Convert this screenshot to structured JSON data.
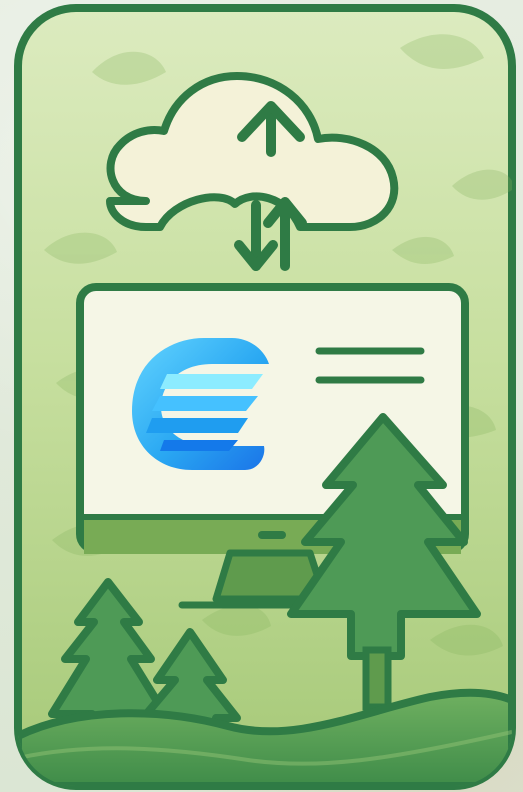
{
  "illustration": {
    "subject": "cloud-sync-eco-computer",
    "icons": [
      "leaf-icon",
      "cloud-icon",
      "up-arrow-icon",
      "sync-arrows-icon",
      "monitor-icon",
      "brand-logo-icon",
      "text-lines-icon",
      "pine-tree-icon"
    ]
  },
  "colors": {
    "frame_outline": "#2f7b45",
    "panel_light": "#dcebbf",
    "panel_mid": "#b7d68f",
    "panel_bottom": "#a6c978",
    "tree_fill": "#4e9a56",
    "tree_dark": "#2b7a43",
    "cloud_fill": "#f4f2d8",
    "screen_fill": "#f5f6e6",
    "logo_blue": "#2aa8f2",
    "logo_cyan": "#63d4ff",
    "logo_dark": "#1a73e8"
  }
}
